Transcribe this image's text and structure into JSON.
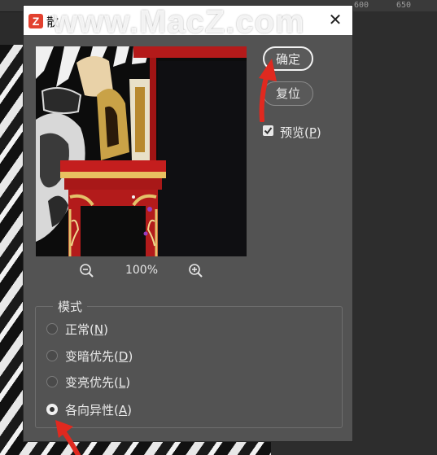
{
  "workspace": {
    "ruler_ticks": [
      "600",
      "650"
    ]
  },
  "dialog": {
    "title": "散",
    "watermark": "www.MacZ.com",
    "app_icon_letter": "Z",
    "close_symbol": "✕"
  },
  "preview": {
    "zoom_level": "100%",
    "zoom_out_icon": "zoom-out-icon",
    "zoom_in_icon": "zoom-in-icon"
  },
  "buttons": {
    "ok_label": "确定",
    "reset_label": "复位"
  },
  "preview_toggle": {
    "label": "预览",
    "mnemonic": "P",
    "checked": true
  },
  "mode": {
    "legend": "模式",
    "options": [
      {
        "label": "正常",
        "mnemonic": "N",
        "selected": false
      },
      {
        "label": "变暗优先",
        "mnemonic": "D",
        "selected": false
      },
      {
        "label": "变亮优先",
        "mnemonic": "L",
        "selected": false
      },
      {
        "label": "各向异性",
        "mnemonic": "A",
        "selected": true
      }
    ]
  },
  "colors": {
    "dialog_bg": "#535353",
    "annotation_red": "#e0291f",
    "logo_red": "#e2412f"
  }
}
